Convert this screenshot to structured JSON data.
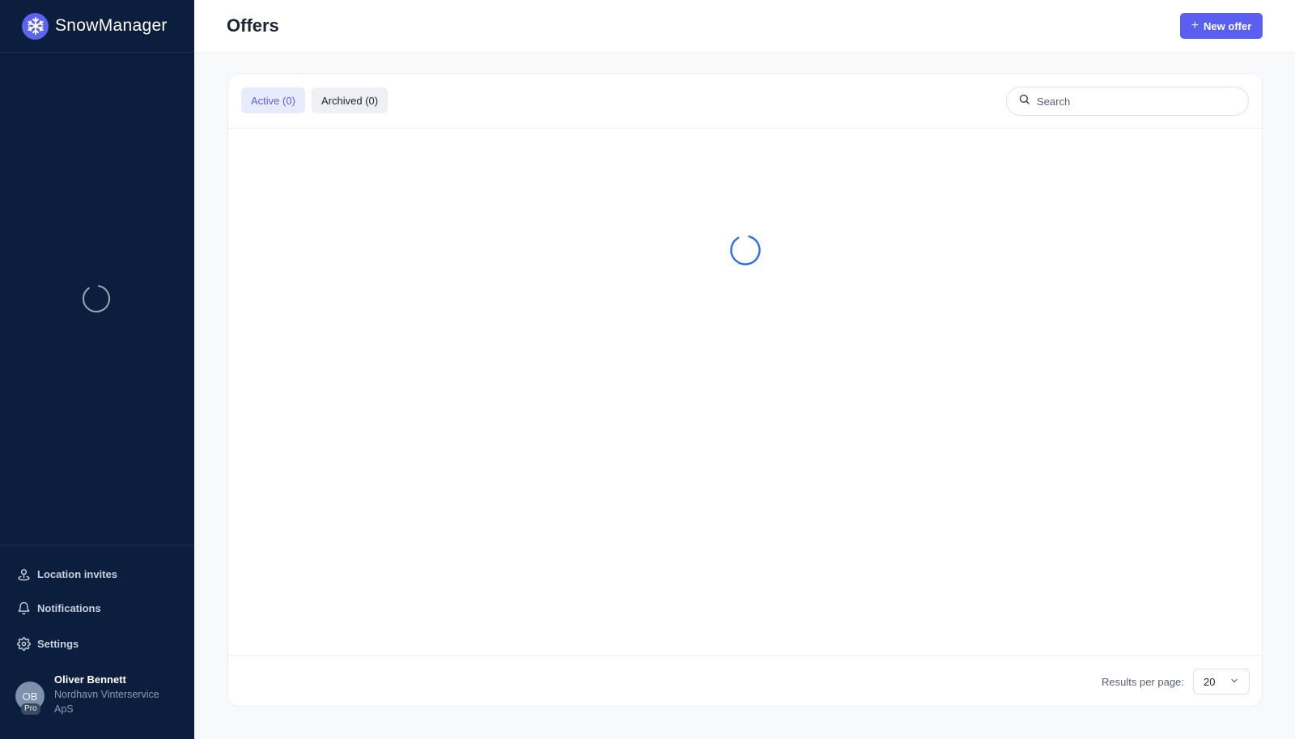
{
  "app": {
    "name": "SnowManager",
    "logo_icon": "snowflake-icon"
  },
  "colors": {
    "sidebar_bg": "#0c1e3e",
    "accent": "#5a5ff0",
    "spinner_blue": "#2f6fe6"
  },
  "sidebar": {
    "items": [
      {
        "label": "Location invites",
        "icon": "location-pin-icon"
      },
      {
        "label": "Notifications",
        "icon": "bell-icon"
      },
      {
        "label": "Settings",
        "icon": "gear-icon"
      }
    ],
    "user": {
      "initials": "OB",
      "badge": "Pro",
      "name": "Oliver Bennett",
      "org": "Nordhavn Vinterservice ApS"
    }
  },
  "header": {
    "title": "Offers",
    "new_button": "New offer"
  },
  "tabs": {
    "active": {
      "label": "Active",
      "count": "(0)"
    },
    "archived": {
      "label": "Archived",
      "count": "(0)"
    }
  },
  "search": {
    "placeholder": "Search",
    "value": ""
  },
  "footer": {
    "results_label": "Results per page:",
    "results_value": "20"
  }
}
